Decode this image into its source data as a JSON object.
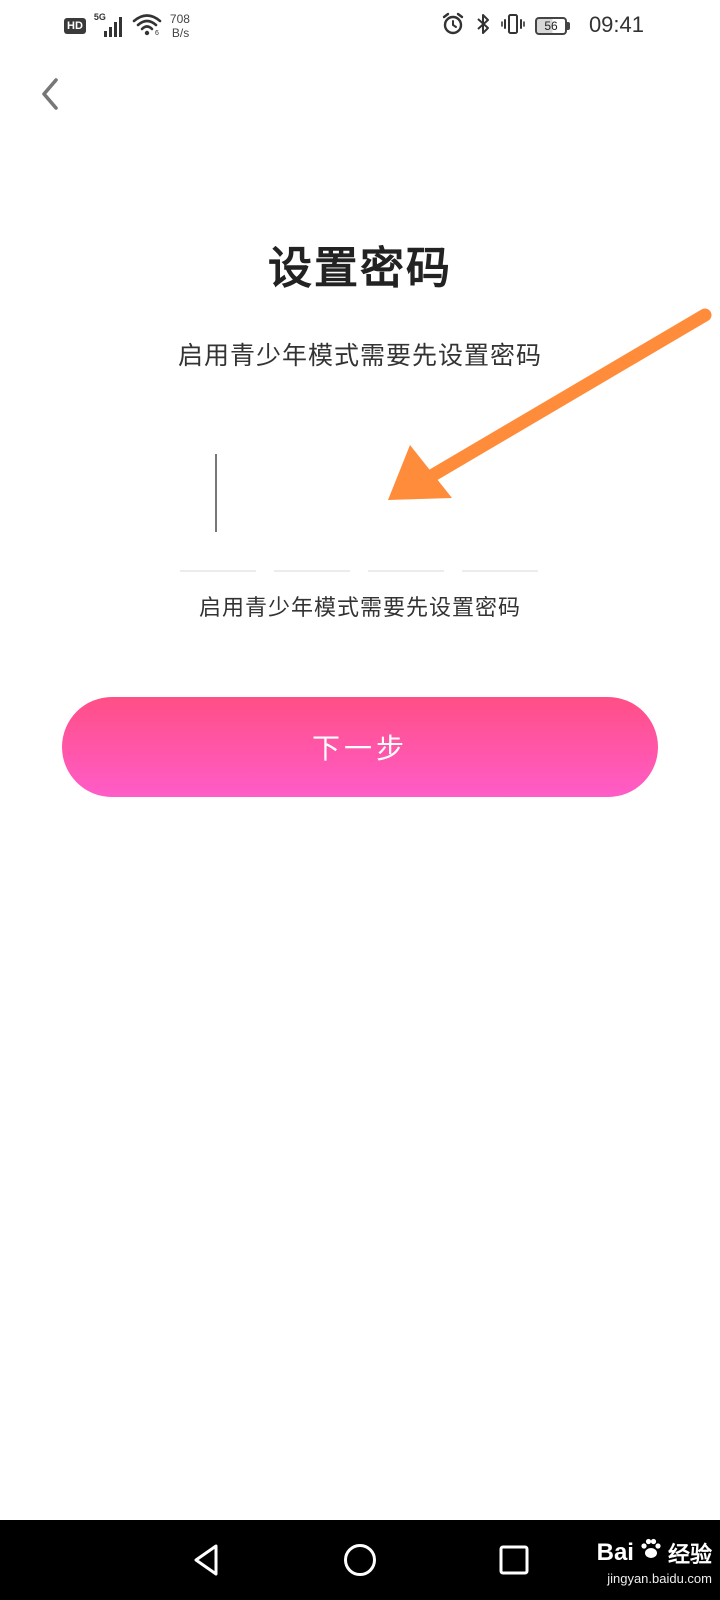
{
  "status_bar": {
    "hd_label": "HD",
    "network_label": "5G",
    "net_speed_value": "708",
    "net_speed_unit": "B/s",
    "battery_level": "56",
    "time": "09:41"
  },
  "header": {
    "back_icon": "chevron-left-icon"
  },
  "main": {
    "title": "设置密码",
    "subtitle": "启用青少年模式需要先设置密码",
    "pin": {
      "length": 4,
      "digits": [
        "",
        "",
        "",
        ""
      ],
      "active_index": 0
    },
    "hint": "启用青少年模式需要先设置密码",
    "next_button_label": "下一步"
  },
  "annotation": {
    "arrow_color": "#ff8c3a"
  },
  "nav_bar": {
    "back_icon": "triangle-back-icon",
    "home_icon": "circle-home-icon",
    "recents_icon": "square-recents-icon"
  },
  "watermark": {
    "brand": "Bai",
    "brand_suffix": "经验",
    "url": "jingyan.baidu.com"
  },
  "colors": {
    "button_gradient_top": "#ff4f86",
    "button_gradient_bottom": "#ff5cc8",
    "annotation_arrow": "#ff8c3a"
  }
}
